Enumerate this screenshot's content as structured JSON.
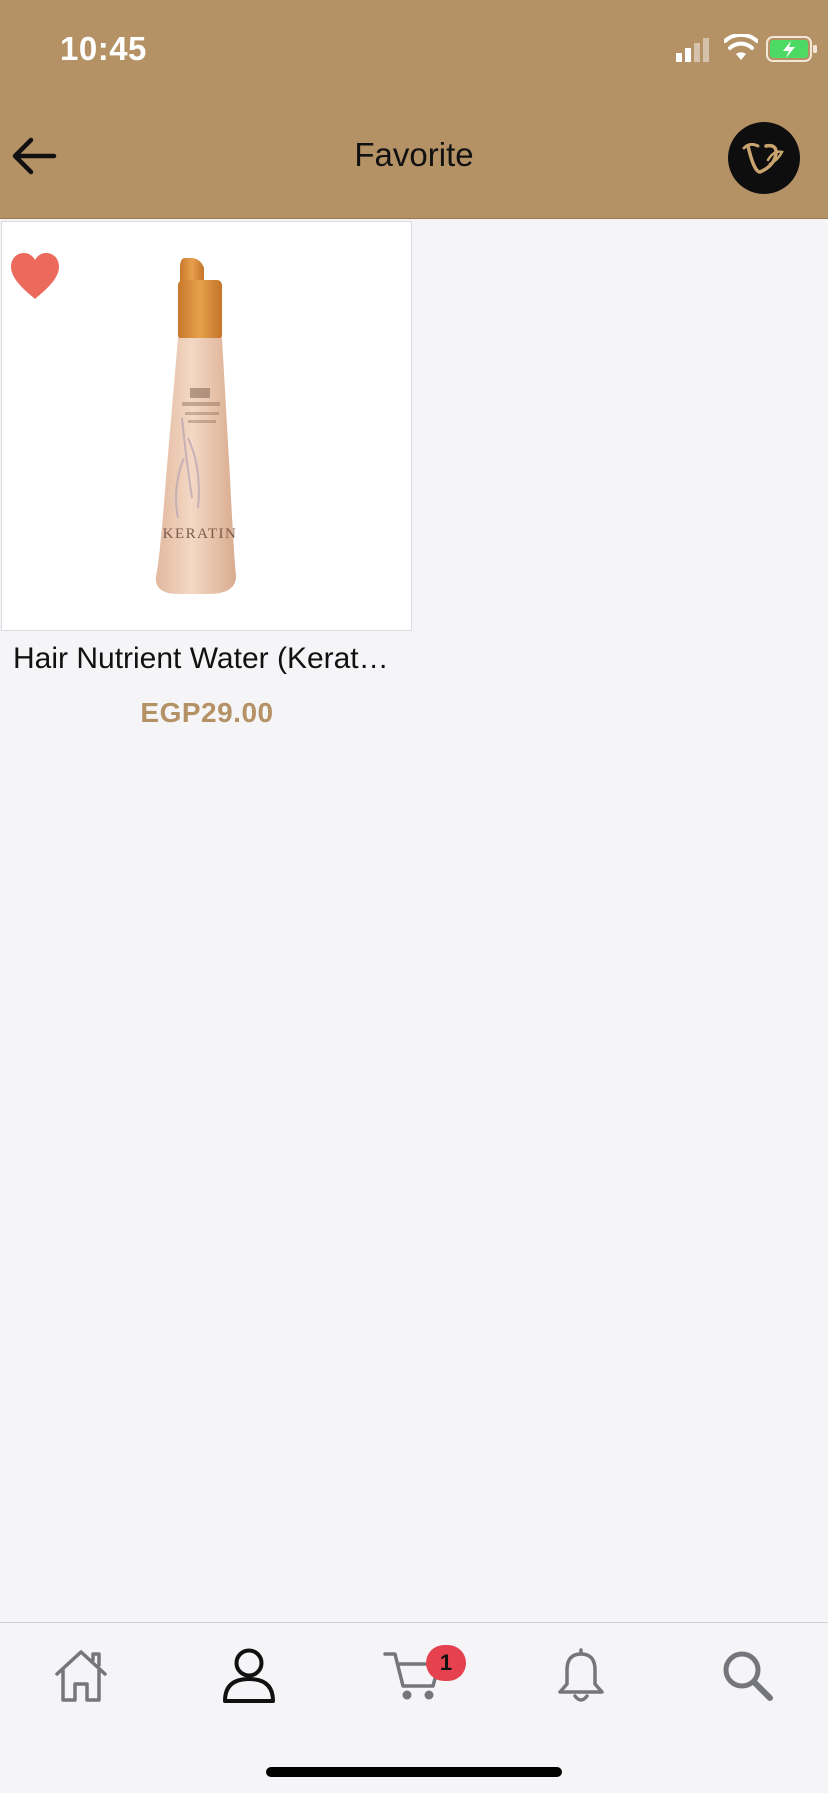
{
  "status_bar": {
    "time": "10:45"
  },
  "header": {
    "title": "Favorite"
  },
  "favorites": [
    {
      "name": "Hair Nutrient Water (Kerat…",
      "price": "EGP29.00",
      "favorited": true,
      "bottle_label": "KERATIN"
    }
  ],
  "tabbar": {
    "cart_badge": "1"
  },
  "colors": {
    "brand": "#b59166",
    "heart": "#ec6a5c",
    "badge": "#e5414f",
    "background": "#f5f5f7"
  },
  "icons": [
    "signal-icon",
    "wifi-icon",
    "battery-charging-icon",
    "back-arrow-icon",
    "brand-logo",
    "heart-icon",
    "home-icon",
    "profile-icon",
    "cart-icon",
    "bell-icon",
    "search-icon"
  ]
}
